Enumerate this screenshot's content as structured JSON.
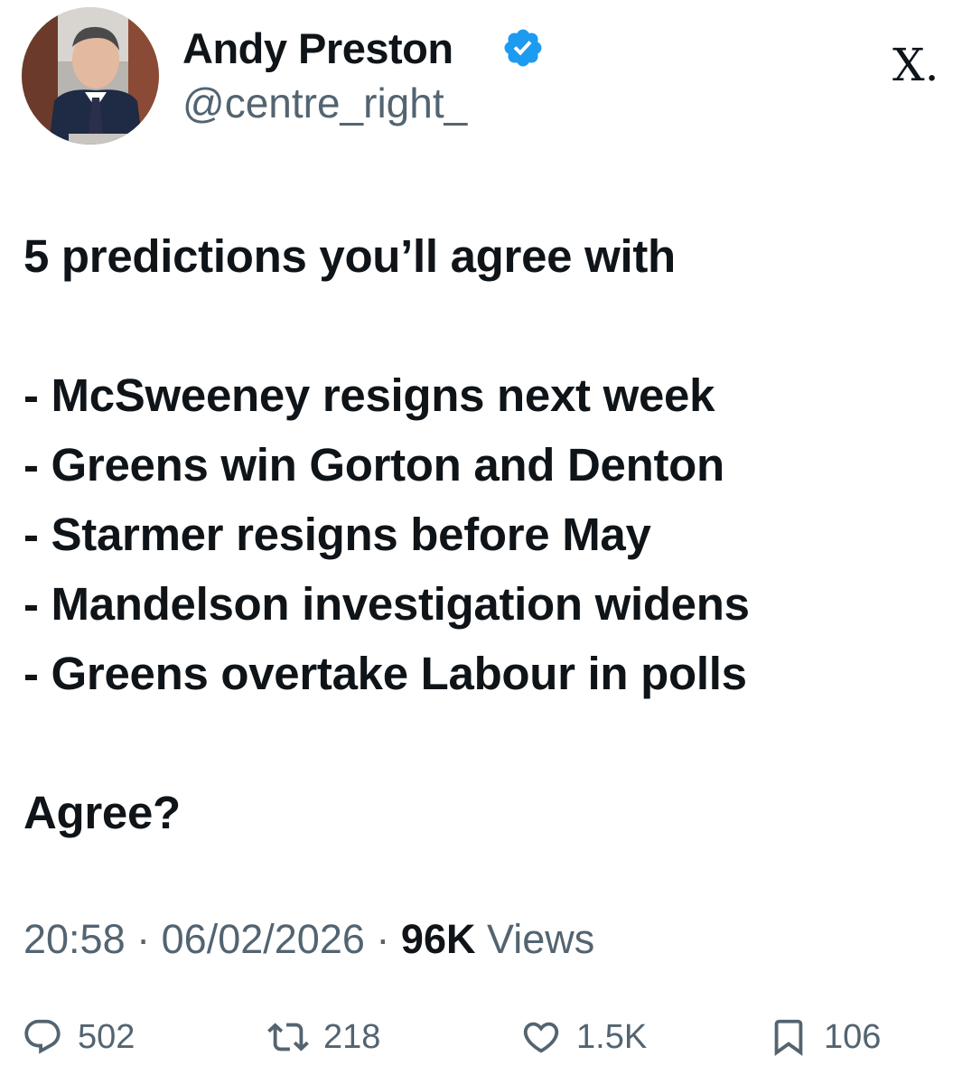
{
  "author": {
    "name": "Andy Preston",
    "handle": "@centre_right_",
    "verified": true,
    "verified_color": "#1d9bf0"
  },
  "platform_logo": "X.",
  "tweet": {
    "lines": [
      "5 predictions you’ll agree with",
      "",
      "- McSweeney resigns next week",
      "- Greens win Gorton and Denton",
      "- Starmer resigns before May",
      "- Mandelson investigation widens",
      "- Greens overtake Labour in polls",
      "",
      "Agree?"
    ]
  },
  "meta": {
    "time": "20:58",
    "separator": "·",
    "date": "06/02/2026",
    "views_count": "96K",
    "views_label": "Views"
  },
  "actions": {
    "replies": "502",
    "reposts": "218",
    "likes": "1.5K",
    "bookmarks": "106"
  },
  "colors": {
    "text": "#0f1419",
    "secondary": "#536471"
  }
}
